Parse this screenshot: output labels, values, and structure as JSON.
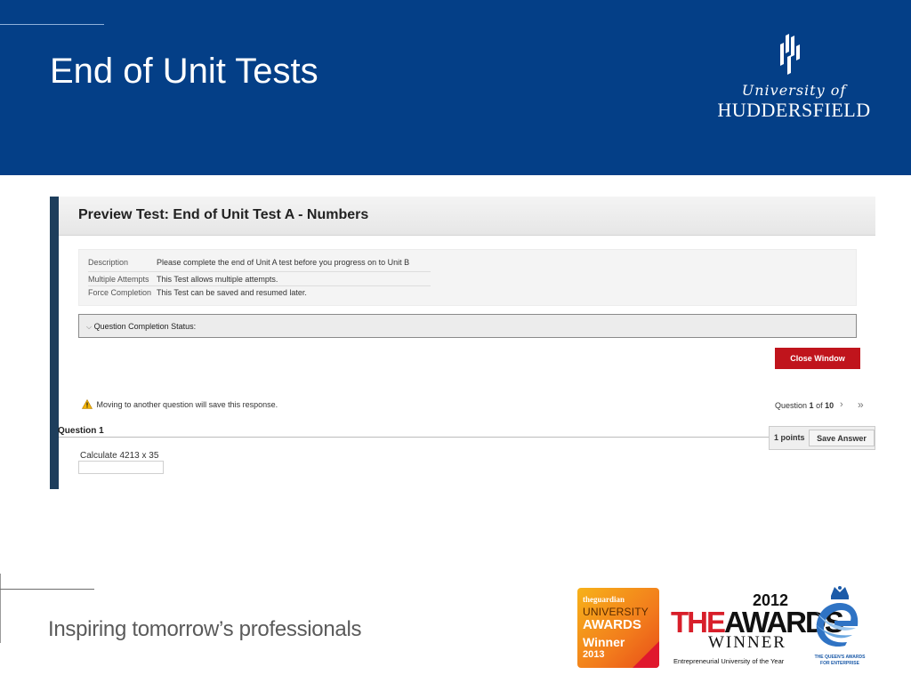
{
  "slide": {
    "title": "End of Unit Tests",
    "logo": {
      "line1": "University of",
      "line2": "HUDDERSFIELD"
    },
    "tagline": "Inspiring tomorrow’s professionals"
  },
  "screenshot": {
    "preview_title": "Preview Test: End of Unit Test A - Numbers",
    "details": [
      {
        "label": "Description",
        "value": "Please complete the end of Unit A test before you progress on to Unit B"
      },
      {
        "label": "Multiple Attempts",
        "value": "This Test allows multiple attempts."
      },
      {
        "label": "Force Completion",
        "value": "This Test can be saved and resumed later."
      }
    ],
    "completion_status": "Question Completion Status:",
    "close_button": "Close Window",
    "warning": "Moving to another question will save this response.",
    "nav": {
      "prefix": "Question",
      "current": "1",
      "of": "of",
      "total": "10",
      "next": "›",
      "last": "»"
    },
    "question": {
      "title": "Question 1",
      "points": "1 points",
      "save_button": "Save Answer",
      "text": "Calculate 4213 x 35",
      "answer_value": ""
    }
  },
  "awards": {
    "guardian": {
      "top": "theguardian",
      "line1": "UNIVERSITY",
      "line2": "AWARDS",
      "line3": "Winner",
      "year": "2013"
    },
    "the": {
      "year": "2012",
      "logo_the": "THE",
      "logo_awards": "AWARDS",
      "winner": "WINNER",
      "subtitle": "Entrepreneurial University of the Year"
    },
    "queens": {
      "line1": "THE QUEEN'S AWARDS",
      "line2": "FOR ENTERPRISE"
    }
  },
  "colors": {
    "header_blue": "#043f87",
    "close_red": "#c0141c",
    "sidebar_navy": "#1e3e5c"
  }
}
